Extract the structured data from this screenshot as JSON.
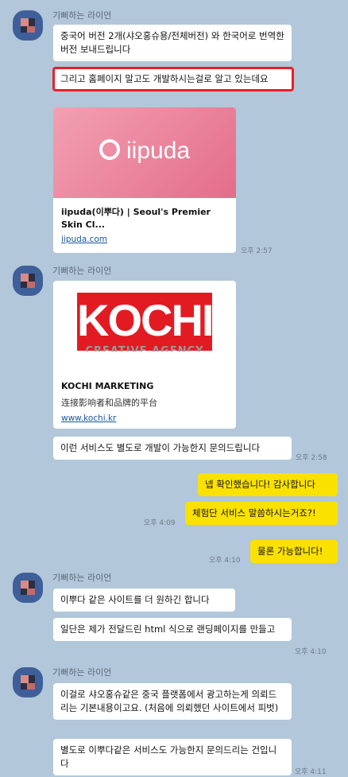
{
  "sender_name": "기뻐하는 라이언",
  "groups": [
    {
      "messages": [
        {
          "text": "중국어 버전 2개(샤오홍슈용/전체버전) 와 한국어로 번역한 버전 보내드립니다"
        },
        {
          "text": "그리고 홈페이지 말고도 개발하시는걸로 알고 있는데요",
          "highlighted": true
        }
      ],
      "link_card": {
        "brand": "iipuda",
        "title": "iipuda(이뿌다) | Seoul's Premier Skin Cl...",
        "url": "iipuda.com"
      },
      "time": "오후 2:57"
    },
    {
      "link_card": {
        "brand": "KOCHI",
        "subbrand": "CREATIVE AGENCY",
        "title": "KOCHI MARKETING",
        "desc": "连接影响者和品牌的平台",
        "url": "www.kochi.kr"
      },
      "messages": [
        {
          "text": "이런 서비스도 별도로 개발이 가능한지 문의드립니다"
        }
      ],
      "time": "오후 2:58"
    }
  ],
  "my_messages": [
    {
      "text": "넵 확인했습니다! 감사합니다"
    },
    {
      "text": "체험단 서비스 말씀하시는거죠?!",
      "time": "오후 4:09"
    },
    {
      "text": "물론 가능합니다!",
      "time": "오후 4:10"
    }
  ],
  "group3": {
    "messages": [
      {
        "text": "이뿌다 같은 사이트를 더 원하긴 합니다"
      },
      {
        "text": "일단은 제가 전달드린 html 식으로 랜딩페이지를 만들고"
      }
    ],
    "time": "오후 4:10"
  },
  "group4": {
    "messages": [
      {
        "text": "이걸로 샤오홍슈같은 중국 플랫폼에서 광고하는게 의뢰드리는 기본내용이고요. (처음에 의뢰했던 사이트에서 피벗)"
      },
      {
        "text": "별도로 이뿌다같은 서비스도 가능한지 문의드리는 건입니다"
      }
    ],
    "time": "오후 4:11"
  },
  "colors": {
    "background": "#b2c7d9",
    "my_bubble": "#fae100",
    "highlight": "#e8202a",
    "iipuda_pink": "#ee7f98",
    "kochi_red": "#e21b23"
  },
  "icons": [
    "avatar-pixelated"
  ]
}
